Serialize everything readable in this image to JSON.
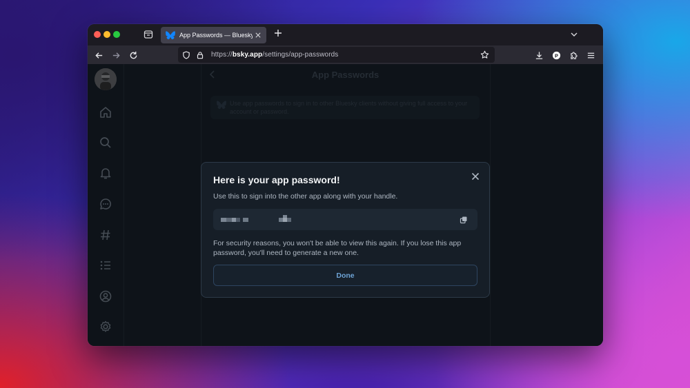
{
  "browser": {
    "tab": {
      "title": "App Passwords — Bluesky"
    },
    "url": {
      "host": "bsky.app",
      "path": "/settings/app-passwords",
      "scheme": "https://"
    }
  },
  "page": {
    "title": "App Passwords",
    "info_text": "Use app passwords to sign in to other Bluesky clients without giving full access to your account or password."
  },
  "modal": {
    "title": "Here is your app password!",
    "subtitle": "Use this to sign into the other app along with your handle.",
    "note": "For security reasons, you won't be able to view this again. If you lose this app password, you'll need to generate a new one.",
    "done_label": "Done"
  },
  "colors": {
    "accent": "#6ea4d6",
    "page_bg": "#161e27",
    "modal_border": "#2d3a48"
  },
  "icons": {
    "sidebar": [
      "home-icon",
      "search-icon",
      "notifications-icon",
      "chat-icon",
      "feeds-hash-icon",
      "lists-icon",
      "profile-icon",
      "settings-icon"
    ]
  }
}
